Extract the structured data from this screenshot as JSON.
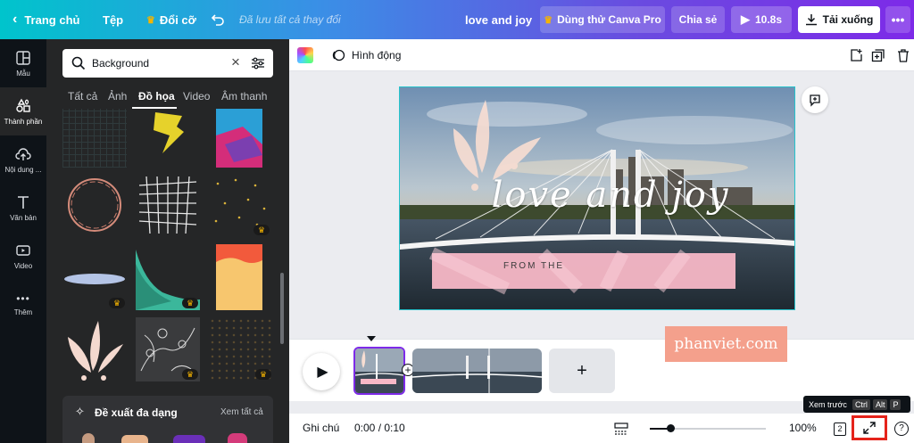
{
  "topbar": {
    "home": "Trang chủ",
    "file": "Tệp",
    "resize": "Đổi cỡ",
    "saved_status": "Đã lưu tất cả thay đổi",
    "design_title": "love and joy",
    "try_pro": "Dùng thử Canva Pro",
    "share": "Chia sẻ",
    "duration": "10.8s",
    "download": "Tải xuống"
  },
  "rail": {
    "items": [
      {
        "label": "Mẫu"
      },
      {
        "label": "Thành phần"
      },
      {
        "label": "Nội dung ..."
      },
      {
        "label": "Văn bản"
      },
      {
        "label": "Video"
      },
      {
        "label": "Thêm"
      }
    ]
  },
  "panel": {
    "search_value": "Background",
    "tabs": [
      "Tất cả",
      "Ảnh",
      "Đồ họa",
      "Video",
      "Âm thanh"
    ],
    "suggest_title": "Đề xuất đa dạng",
    "suggest_link": "Xem tất cả"
  },
  "toolbar2": {
    "animate": "Hình động"
  },
  "design": {
    "script_text": "love and joy",
    "banner_text": "FROM THE"
  },
  "timeline": {
    "add_page": "+"
  },
  "watermark": "phanviet.com",
  "tooltip": {
    "label": "Xem trước",
    "keys": [
      "Ctrl",
      "Alt",
      "P"
    ]
  },
  "bottombar": {
    "notes": "Ghi chú",
    "time": "0:00 / 0:10",
    "zoom": "100%",
    "pages": "2",
    "help": "?"
  },
  "colors": {
    "accent": "#7d2ae8",
    "highlight_box": "#e5231b",
    "watermark_bg": "#f4a08c"
  }
}
